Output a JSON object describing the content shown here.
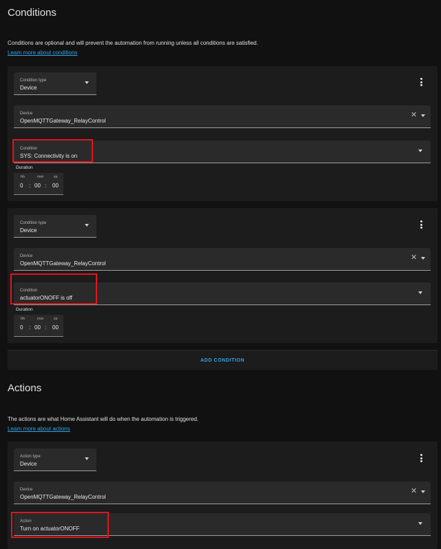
{
  "conditions": {
    "title": "Conditions",
    "intro": "Conditions are optional and will prevent the automation from running unless all conditions are satisfied.",
    "learn_more": "Learn more about conditions",
    "add_button": "ADD CONDITION",
    "cards": [
      {
        "type_label": "Condition type",
        "type_value": "Device",
        "device_label": "Device",
        "device_value": "OpenMQTTGateway_RelayControl",
        "condition_label": "Condition",
        "condition_value": "SYS: Connectivity is on",
        "duration_label": "Duration",
        "duration": {
          "hh_label": "hh",
          "mm_label": "mm",
          "ss_label": "ss",
          "hh": "0",
          "mm": "00",
          "ss": "00"
        }
      },
      {
        "type_label": "Condition type",
        "type_value": "Device",
        "device_label": "Device",
        "device_value": "OpenMQTTGateway_RelayControl",
        "condition_label": "Condition",
        "condition_value": "actuatorONOFF is off",
        "duration_label": "Duration",
        "duration": {
          "hh_label": "hh",
          "mm_label": "mm",
          "ss_label": "ss",
          "hh": "0",
          "mm": "00",
          "ss": "00"
        }
      }
    ]
  },
  "actions": {
    "title": "Actions",
    "intro": "The actions are what Home Assistant will do when the automation is triggered.",
    "learn_more": "Learn more about actions",
    "cards": [
      {
        "type_label": "Action type",
        "type_value": "Device",
        "device_label": "Device",
        "device_value": "OpenMQTTGateway_RelayControl",
        "action_label": "Action",
        "action_value": "Turn on actuatorONOFF"
      }
    ]
  },
  "icons": {
    "clear": "close-icon",
    "dropdown": "chevron-down-icon",
    "menu": "dots-vertical-icon"
  },
  "colors": {
    "accent": "#2fa5e8",
    "highlight": "#e0161d",
    "card": "#1c1c1c",
    "background": "#111111"
  }
}
